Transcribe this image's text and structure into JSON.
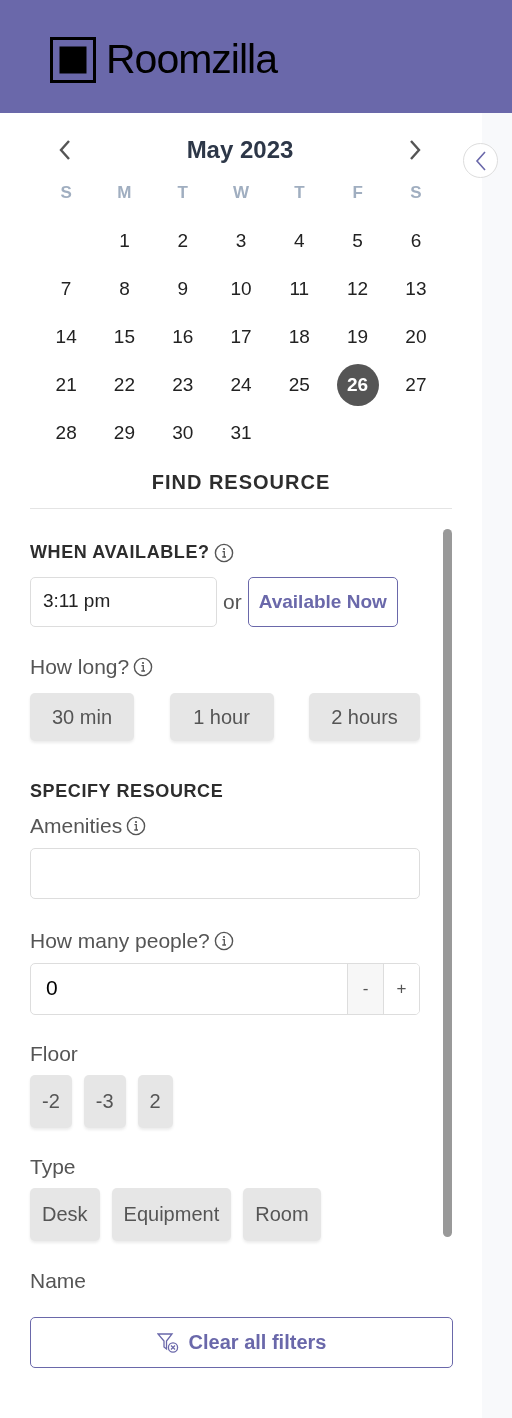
{
  "header": {
    "logo_text": "Roomzilla"
  },
  "calendar": {
    "month": "May 2023",
    "weekdays": [
      "S",
      "M",
      "T",
      "W",
      "T",
      "F",
      "S"
    ],
    "weeks": [
      [
        {
          "day": "1",
          "selected": false
        },
        {
          "day": "2",
          "selected": false
        },
        {
          "day": "3",
          "selected": false
        },
        {
          "day": "4",
          "selected": false
        },
        {
          "day": "5",
          "selected": false
        },
        {
          "day": "6",
          "selected": false
        }
      ],
      [
        {
          "day": "7",
          "selected": false
        },
        {
          "day": "8",
          "selected": false
        },
        {
          "day": "9",
          "selected": false
        },
        {
          "day": "10",
          "selected": false
        },
        {
          "day": "11",
          "selected": false
        },
        {
          "day": "12",
          "selected": false
        },
        {
          "day": "13",
          "selected": false
        }
      ],
      [
        {
          "day": "14",
          "selected": false
        },
        {
          "day": "15",
          "selected": false
        },
        {
          "day": "16",
          "selected": false
        },
        {
          "day": "17",
          "selected": false
        },
        {
          "day": "18",
          "selected": false
        },
        {
          "day": "19",
          "selected": false
        },
        {
          "day": "20",
          "selected": false
        }
      ],
      [
        {
          "day": "21",
          "selected": false
        },
        {
          "day": "22",
          "selected": false
        },
        {
          "day": "23",
          "selected": false
        },
        {
          "day": "24",
          "selected": false
        },
        {
          "day": "25",
          "selected": false
        },
        {
          "day": "26",
          "selected": true
        },
        {
          "day": "27",
          "selected": false
        }
      ],
      [
        {
          "day": "28",
          "selected": false
        },
        {
          "day": "29",
          "selected": false
        },
        {
          "day": "30",
          "selected": false
        },
        {
          "day": "31",
          "selected": false
        }
      ]
    ]
  },
  "find_resource": {
    "title": "FIND RESOURCE",
    "when_available": {
      "label": "WHEN AVAILABLE?",
      "time": "3:11 pm",
      "or": "or",
      "now_button": "Available Now"
    },
    "how_long": {
      "label": "How long?",
      "options": [
        {
          "label": "30 min",
          "selected": false
        },
        {
          "label": "1 hour",
          "selected": false
        },
        {
          "label": "2 hours",
          "selected": false
        }
      ]
    },
    "specify_title": "SPECIFY RESOURCE",
    "amenities": {
      "label": "Amenities"
    },
    "people": {
      "label": "How many people?",
      "value": "0",
      "minus": "-",
      "plus": "+"
    },
    "floor": {
      "label": "Floor",
      "options": [
        {
          "label": "-2",
          "selected": false
        },
        {
          "label": "-3",
          "selected": false
        },
        {
          "label": "2",
          "selected": false
        }
      ]
    },
    "type": {
      "label": "Type",
      "options": [
        {
          "label": "Desk",
          "selected": false
        },
        {
          "label": "Equipment",
          "selected": false
        },
        {
          "label": "Room",
          "selected": false
        }
      ]
    },
    "name": {
      "label": "Name"
    },
    "clear_button": "Clear all filters"
  }
}
